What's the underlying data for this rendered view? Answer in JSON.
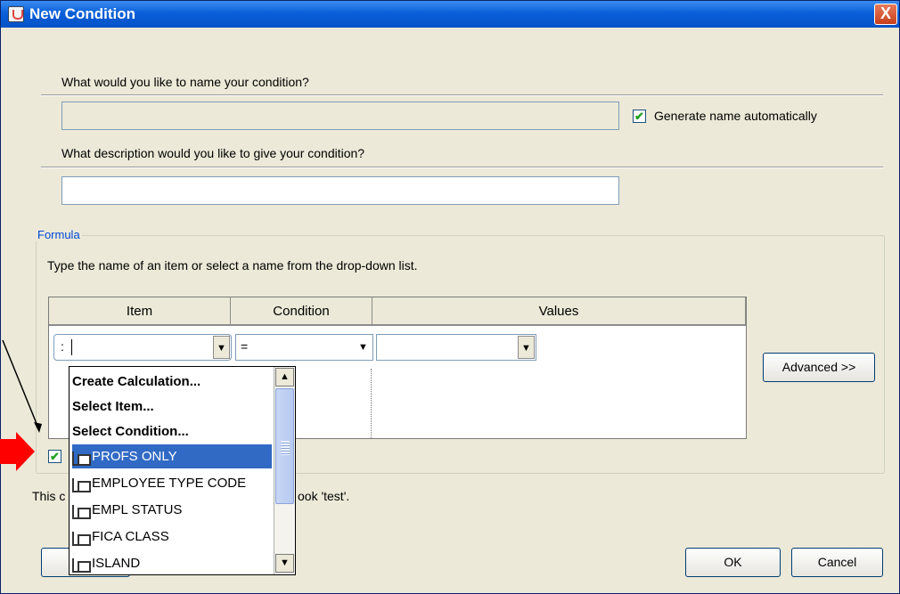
{
  "window": {
    "title": "New Condition",
    "close_label": "X"
  },
  "name_section": {
    "question": "What would you like to name your condition?",
    "name_value": "",
    "auto_name_label": "Generate name automatically",
    "auto_name_checked": true
  },
  "description_section": {
    "question": "What description would you like to give your condition?",
    "value": ""
  },
  "formula": {
    "legend": "Formula",
    "instructions": "Type the name of an item or select a name from the drop-down list.",
    "columns": [
      "Item",
      "Condition",
      "Values"
    ],
    "row": {
      "prefix": ":",
      "item_value": "",
      "condition_value": "=",
      "values_value": ""
    },
    "advanced_button": "Advanced >>",
    "row_checkbox_checked": true
  },
  "dropdown": {
    "actions": [
      "Create Calculation...",
      "Select Item...",
      "Select Condition..."
    ],
    "items": [
      "PROFS ONLY",
      "EMPLOYEE TYPE CODE",
      "EMPL STATUS",
      "FICA CLASS",
      "ISLAND"
    ],
    "selected_item": "PROFS ONLY"
  },
  "footer": {
    "info_prefix": "This c",
    "info_suffix": "ook 'test'.",
    "ok_button": "OK",
    "cancel_button": "Cancel"
  },
  "colors": {
    "titlebar": "#0a5fd8",
    "dialog_bg": "#ece9d8",
    "selection": "#316ac5",
    "annotation_arrow": "#ff0000"
  }
}
